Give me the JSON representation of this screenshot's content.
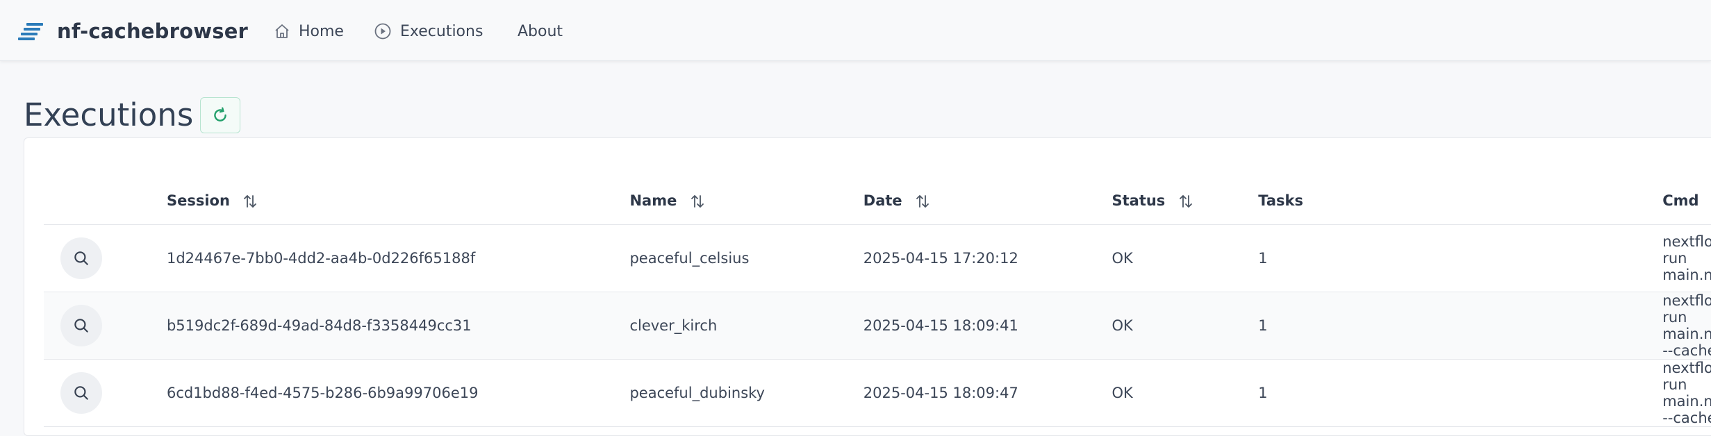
{
  "app": {
    "brand": "nf-cachebrowser",
    "logo_icon": "stack-lines-icon",
    "brand_color": "#2b7bb9"
  },
  "nav": {
    "home": {
      "label": "Home",
      "icon": "home-icon"
    },
    "executions": {
      "label": "Executions",
      "icon": "play-circle-icon"
    },
    "about": {
      "label": "About"
    }
  },
  "page": {
    "title": "Executions",
    "refresh_icon": "refresh-icon",
    "accent": "#22a06b"
  },
  "table": {
    "columns": [
      {
        "label": "Session",
        "sortable": true
      },
      {
        "label": "Name",
        "sortable": true
      },
      {
        "label": "Date",
        "sortable": true
      },
      {
        "label": "Status",
        "sortable": true
      },
      {
        "label": "Tasks",
        "sortable": false
      },
      {
        "label": "Cmd",
        "sortable": false
      }
    ],
    "rows": [
      {
        "session": "1d24467e-7bb0-4dd2-aa4b-0d226f65188f",
        "name": "peaceful_celsius",
        "date": "2025-04-15 17:20:12",
        "status": "OK",
        "tasks": "1",
        "cmd": "nextflow run main.nf"
      },
      {
        "session": "b519dc2f-689d-49ad-84d8-f3358449cc31",
        "name": "clever_kirch",
        "date": "2025-04-15 18:09:41",
        "status": "OK",
        "tasks": "1",
        "cmd": "nextflow run main.nf --cache"
      },
      {
        "session": "6cd1bd88-f4ed-4575-b286-6b9a99706e19",
        "name": "peaceful_dubinsky",
        "date": "2025-04-15 18:09:47",
        "status": "OK",
        "tasks": "1",
        "cmd": "nextflow run main.nf --cache"
      }
    ]
  }
}
